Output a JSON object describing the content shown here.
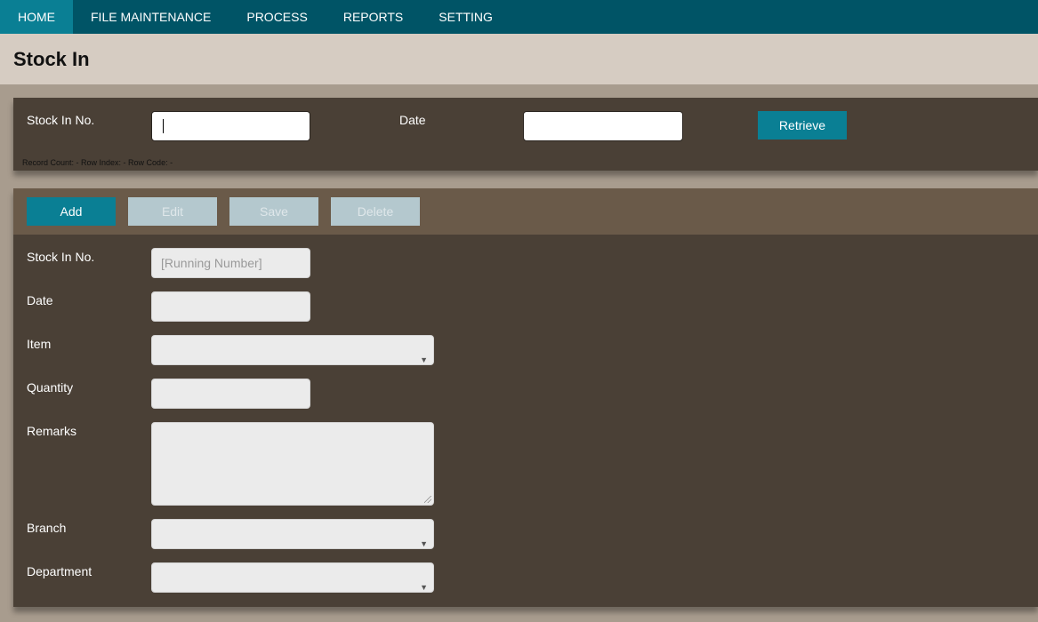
{
  "nav": {
    "items": [
      {
        "label": "HOME",
        "active": true
      },
      {
        "label": "FILE MAINTENANCE",
        "active": false
      },
      {
        "label": "PROCESS",
        "active": false
      },
      {
        "label": "REPORTS",
        "active": false
      },
      {
        "label": "SETTING",
        "active": false
      }
    ]
  },
  "page": {
    "title": "Stock In"
  },
  "search": {
    "stock_in_no_label": "Stock In No.",
    "stock_in_no_value": "",
    "date_label": "Date",
    "date_value": "",
    "retrieve_label": "Retrieve",
    "record_count_text": "Record Count: - Row Index: - Row Code: -"
  },
  "toolbar": {
    "add_label": "Add",
    "edit_label": "Edit",
    "save_label": "Save",
    "delete_label": "Delete"
  },
  "form": {
    "stock_in_no_label": "Stock In No.",
    "stock_in_no_placeholder": "[Running Number]",
    "date_label": "Date",
    "item_label": "Item",
    "quantity_label": "Quantity",
    "remarks_label": "Remarks",
    "branch_label": "Branch",
    "department_label": "Department"
  },
  "colors": {
    "nav_bg": "#005466",
    "nav_active": "#0a7f94",
    "panel_bg": "#4a4036",
    "toolbar_bg": "#6a5a49",
    "primary_button": "#0a7f94",
    "disabled_button": "#b4c8ce"
  },
  "icons": {
    "select_arrow": "chevron-down-icon",
    "textarea_resize": "resize-grip-icon"
  }
}
